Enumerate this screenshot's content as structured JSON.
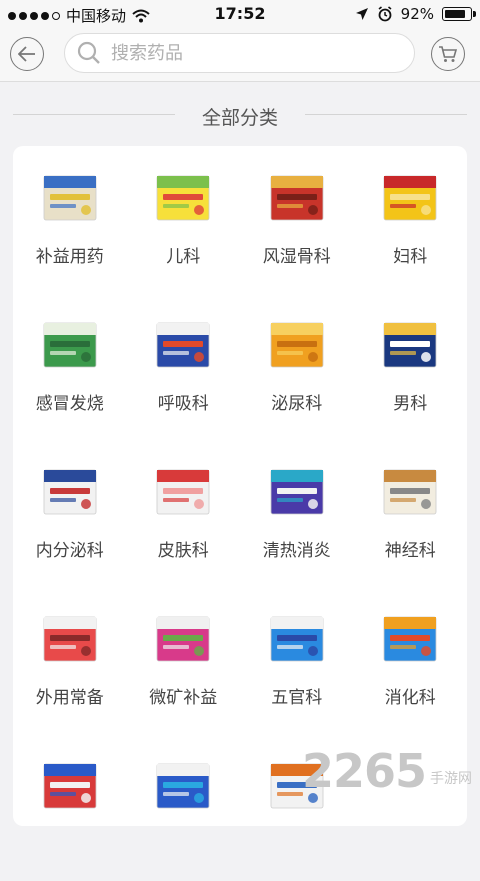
{
  "status_bar": {
    "carrier": "中国移动",
    "time": "17:52",
    "battery_percent": "92%",
    "battery_level": 0.92
  },
  "header": {
    "back_icon": "back-arrow-icon",
    "search_placeholder": "搜索药品",
    "cart_icon": "shopping-cart-icon"
  },
  "section": {
    "title": "全部分类"
  },
  "categories": [
    {
      "label": "补益用药",
      "colors": [
        "#e8e0c8",
        "#3a6fc4",
        "#e2c13a"
      ]
    },
    {
      "label": "儿科",
      "colors": [
        "#f7e03a",
        "#7cc04c",
        "#e04a3a"
      ]
    },
    {
      "label": "风湿骨科",
      "colors": [
        "#c8342a",
        "#e8b040",
        "#7a2018"
      ]
    },
    {
      "label": "妇科",
      "colors": [
        "#f3c418",
        "#c8282a",
        "#f7e08a"
      ]
    },
    {
      "label": "感冒发烧",
      "colors": [
        "#3c9a4c",
        "#e8f0e0",
        "#2a6e3a"
      ]
    },
    {
      "label": "呼吸科",
      "colors": [
        "#2a4aa8",
        "#f2f2f2",
        "#e24a2a"
      ]
    },
    {
      "label": "泌尿科",
      "colors": [
        "#f0a020",
        "#f7d060",
        "#c87010"
      ]
    },
    {
      "label": "男科",
      "colors": [
        "#1a3880",
        "#f0c040",
        "#ffffff"
      ]
    },
    {
      "label": "内分泌科",
      "colors": [
        "#f2f2f2",
        "#2a4a9a",
        "#c83a3a"
      ]
    },
    {
      "label": "皮肤科",
      "colors": [
        "#f2f2f2",
        "#d83a3a",
        "#f0a0a0"
      ]
    },
    {
      "label": "清热消炎",
      "colors": [
        "#4a3aa8",
        "#2aa8c8",
        "#f2f2f2"
      ]
    },
    {
      "label": "神经科",
      "colors": [
        "#f2ede0",
        "#c88a40",
        "#888888"
      ]
    },
    {
      "label": "外用常备",
      "colors": [
        "#e84a4a",
        "#f2f2f2",
        "#8a2a2a"
      ]
    },
    {
      "label": "微矿补益",
      "colors": [
        "#d83a8a",
        "#f0f0f0",
        "#6aa84a"
      ]
    },
    {
      "label": "五官科",
      "colors": [
        "#2a8ae0",
        "#f2f2f2",
        "#2a4aa8"
      ]
    },
    {
      "label": "消化科",
      "colors": [
        "#2a8ae0",
        "#f0a020",
        "#e24a2a"
      ]
    },
    {
      "label": "",
      "colors": [
        "#d83a3a",
        "#2a5ac8",
        "#f2f2f2"
      ]
    },
    {
      "label": "",
      "colors": [
        "#2a5ac8",
        "#f2f2f2",
        "#2aa8e0"
      ]
    },
    {
      "label": "",
      "colors": [
        "#f2f2f2",
        "#e07020",
        "#3a6fc4"
      ]
    },
    {
      "label": "",
      "colors": []
    }
  ],
  "watermark": {
    "number": "2265",
    "sub": "手游网"
  }
}
